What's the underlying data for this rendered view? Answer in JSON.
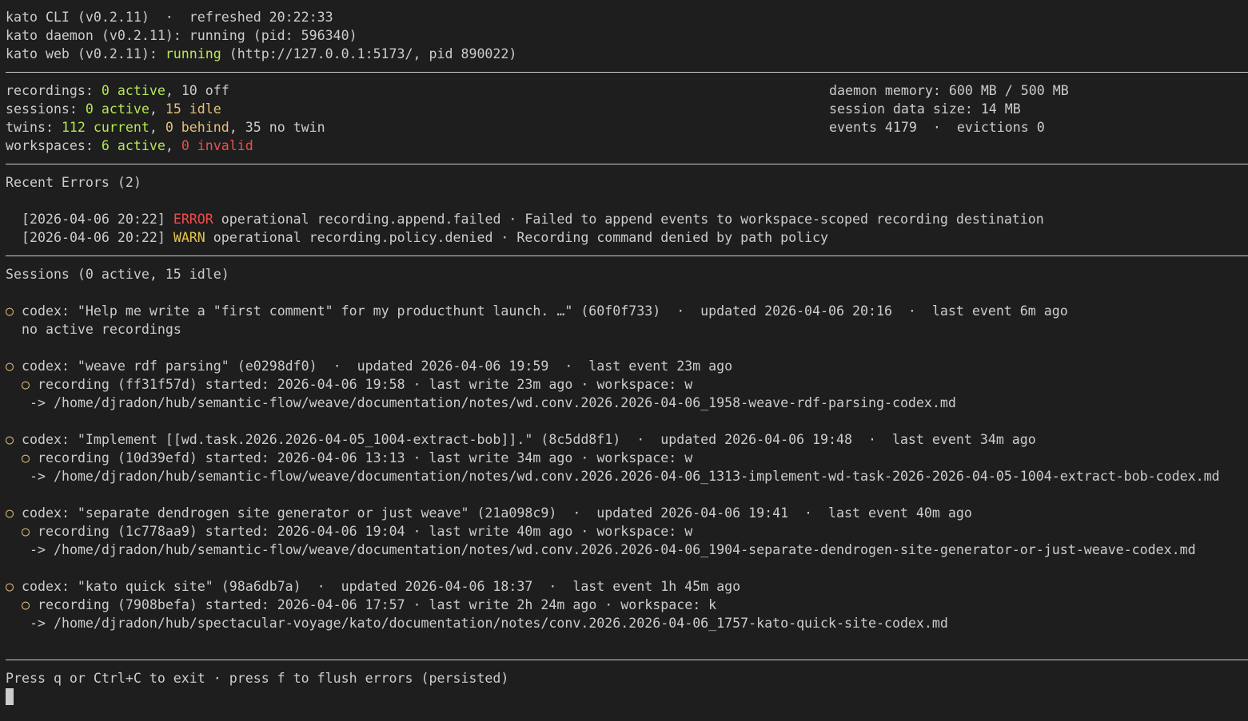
{
  "header": {
    "cli": "kato CLI (v0.2.11)  ·  refreshed 20:22:33",
    "daemon": "kato daemon (v0.2.11): running (pid: 596340)",
    "web_prefix": "kato web (v0.2.11): ",
    "web_status": "running",
    "web_suffix": " (http://127.0.0.1:5173/, pid 890022)"
  },
  "stats": {
    "recordings": {
      "label": "recordings: ",
      "active": "0 active",
      "sep": ", ",
      "off": "10 off"
    },
    "sessions": {
      "label": "sessions: ",
      "active": "0 active",
      "sep": ", ",
      "idle": "15 idle"
    },
    "twins": {
      "label": "twins: ",
      "current": "112 current",
      "sep1": ", ",
      "behind": "0 behind",
      "sep2": ", ",
      "no_twin": "35 no twin"
    },
    "workspaces": {
      "label": "workspaces: ",
      "active": "6 active",
      "sep": ", ",
      "invalid": "0 invalid"
    },
    "daemon_memory": "daemon memory: 600 MB / 500 MB",
    "session_data_size": "session data size: 14 MB",
    "events": "events 4179  ·  evictions 0"
  },
  "errors": {
    "title": "Recent Errors (2)",
    "items": [
      {
        "time": "[2026-04-06 20:22] ",
        "level": "ERROR",
        "message": " operational recording.append.failed · Failed to append events to workspace-scoped recording destination"
      },
      {
        "time": "[2026-04-06 20:22] ",
        "level": "WARN",
        "message": " operational recording.policy.denied · Recording command denied by path policy"
      }
    ]
  },
  "sessions": {
    "title": "Sessions (0 active, 15 idle)",
    "bullet": "○",
    "items": [
      {
        "header": "codex: \"Help me write a \"first comment\" for my producthunt launch. …\" (60f0f733)  ·  updated 2026-04-06 20:16  ·  last event 6m ago",
        "detail": "no active recordings"
      },
      {
        "header": "codex: \"weave rdf parsing\" (e0298df0)  ·  updated 2026-04-06 19:59  ·  last event 23m ago",
        "recording": "recording (ff31f57d) started: 2026-04-06 19:58 · last write 23m ago · workspace: w",
        "path": "-> /home/djradon/hub/semantic-flow/weave/documentation/notes/wd.conv.2026.2026-04-06_1958-weave-rdf-parsing-codex.md"
      },
      {
        "header": "codex: \"Implement [[wd.task.2026.2026-04-05_1004-extract-bob]].\" (8c5dd8f1)  ·  updated 2026-04-06 19:48  ·  last event 34m ago",
        "recording": "recording (10d39efd) started: 2026-04-06 13:13 · last write 34m ago · workspace: w",
        "path": "-> /home/djradon/hub/semantic-flow/weave/documentation/notes/wd.conv.2026.2026-04-06_1313-implement-wd-task-2026-2026-04-05-1004-extract-bob-codex.md"
      },
      {
        "header": "codex: \"separate dendrogen site generator or just weave\" (21a098c9)  ·  updated 2026-04-06 19:41  ·  last event 40m ago",
        "recording": "recording (1c778aa9) started: 2026-04-06 19:04 · last write 40m ago · workspace: w",
        "path": "-> /home/djradon/hub/semantic-flow/weave/documentation/notes/wd.conv.2026.2026-04-06_1904-separate-dendrogen-site-generator-or-just-weave-codex.md"
      },
      {
        "header": "codex: \"kato quick site\" (98a6db7a)  ·  updated 2026-04-06 18:37  ·  last event 1h 45m ago",
        "recording": "recording (7908befa) started: 2026-04-06 17:57 · last write 2h 24m ago · workspace: k",
        "path": "-> /home/djradon/hub/spectacular-voyage/kato/documentation/notes/conv.2026.2026-04-06_1757-kato-quick-site-codex.md"
      }
    ]
  },
  "footer": {
    "help": "Press q or Ctrl+C to exit · press f to flush errors (persisted)"
  },
  "colors": {
    "background": "#1e1e1e",
    "foreground": "#cccccc",
    "green": "#b5e853",
    "yellow": "#e5c07b",
    "red": "#f14c4c"
  }
}
